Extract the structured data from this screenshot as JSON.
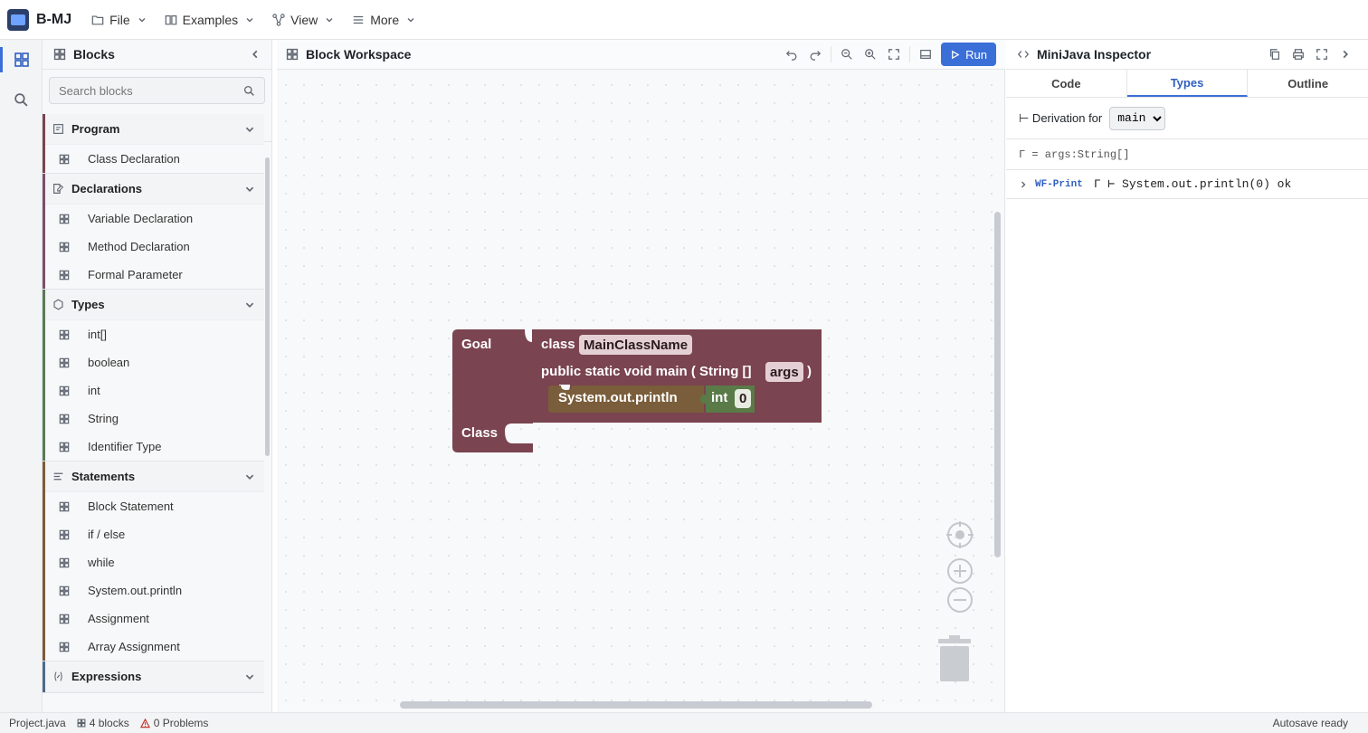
{
  "app": {
    "title": "B-MJ"
  },
  "menu": {
    "file": "File",
    "examples": "Examples",
    "view": "View",
    "more": "More"
  },
  "sidebar": {
    "title": "Blocks",
    "search_placeholder": "Search blocks",
    "categories": [
      {
        "label": "Program",
        "color": "#7a4450",
        "items": [
          "Class Declaration"
        ]
      },
      {
        "label": "Declarations",
        "color": "#7a4e6e",
        "items": [
          "Variable Declaration",
          "Method Declaration",
          "Formal Parameter"
        ]
      },
      {
        "label": "Types",
        "color": "#5a7a58",
        "items": [
          "int[]",
          "boolean",
          "int",
          "String",
          "Identifier Type"
        ]
      },
      {
        "label": "Statements",
        "color": "#7a5d3a",
        "items": [
          "Block Statement",
          "if / else",
          "while",
          "System.out.println",
          "Assignment",
          "Array Assignment"
        ]
      },
      {
        "label": "Expressions",
        "color": "#4f6a8a",
        "items": []
      }
    ]
  },
  "workspace": {
    "title": "Block Workspace",
    "run_label": "Run",
    "blocks": {
      "goal": "Goal",
      "class_kw": "class",
      "class_name": "MainClassName",
      "main_sig": "public static void main ( String []",
      "args": "args",
      "close_paren": ")",
      "println": "System.out.println",
      "int_kw": "int",
      "int_value": "0",
      "class_label": "Class"
    },
    "colors": {
      "goal": "#7a4450",
      "println": "#7a5d3a",
      "int": "#5a7a48"
    }
  },
  "inspector": {
    "title": "MiniJava Inspector",
    "tabs": [
      "Code",
      "Types",
      "Outline"
    ],
    "active_tab": "Types",
    "derivation_label": "⊢ Derivation for",
    "derivation_value": "main",
    "derivation_options": [
      "main"
    ],
    "gamma": "Γ = args:String[]",
    "rule_tag": "WF-Print",
    "rule_judgment": "Γ ⊢ System.out.println(0) ok"
  },
  "statusbar": {
    "file": "Project.java",
    "blocks": "4 blocks",
    "problems": "0 Problems",
    "autosave": "Autosave ready"
  }
}
